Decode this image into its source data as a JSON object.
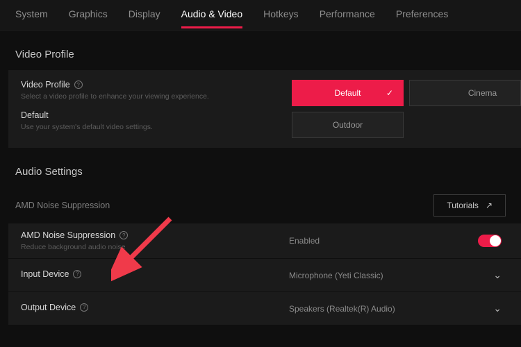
{
  "tabs": {
    "system": "System",
    "graphics": "Graphics",
    "display": "Display",
    "audiovideo": "Audio & Video",
    "hotkeys": "Hotkeys",
    "performance": "Performance",
    "preferences": "Preferences"
  },
  "sections": {
    "video_profile": "Video Profile",
    "audio_settings": "Audio Settings"
  },
  "video_profile_panel": {
    "label": "Video Profile",
    "desc": "Select a video profile to enhance your viewing experience.",
    "default_label": "Default",
    "default_desc": "Use your system's default video settings."
  },
  "profile_buttons": {
    "default": "Default",
    "cinema": "Cinema",
    "outdoor": "Outdoor"
  },
  "noise_bar": {
    "label": "AMD Noise Suppression",
    "tutorials": "Tutorials"
  },
  "rows": {
    "ns_label": "AMD Noise Suppression",
    "ns_desc": "Reduce background audio noise",
    "ns_value": "Enabled",
    "input_label": "Input Device",
    "input_value": "Microphone (Yeti Classic)",
    "output_label": "Output Device",
    "output_value": "Speakers (Realtek(R) Audio)"
  },
  "colors": {
    "accent": "#ed1c49"
  }
}
